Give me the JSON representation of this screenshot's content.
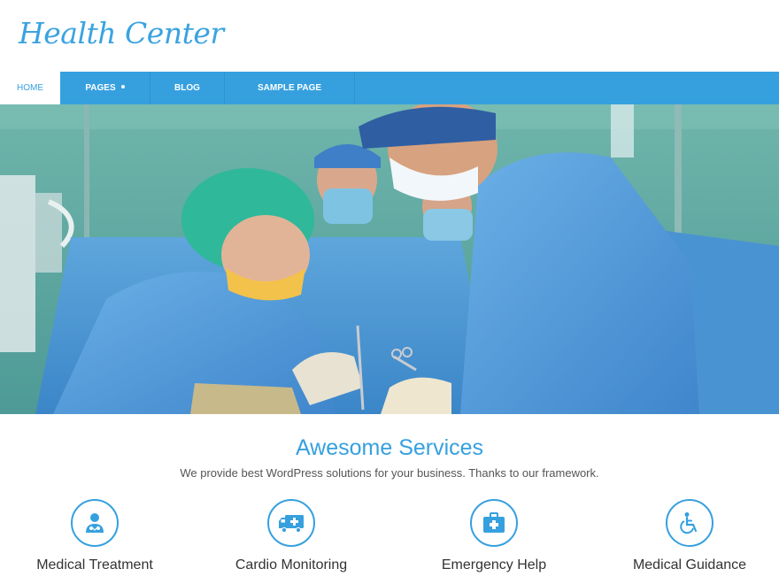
{
  "site": {
    "title": "Health Center"
  },
  "nav": {
    "items": [
      {
        "label": "HOME",
        "active": true
      },
      {
        "label": "PAGES",
        "has_dropdown": true
      },
      {
        "label": "BLOG"
      },
      {
        "label": "SAMPLE PAGE"
      }
    ]
  },
  "services": {
    "title": "Awesome Services",
    "subtitle": "We provide best WordPress solutions for your business. Thanks to our framework.",
    "items": [
      {
        "label": "Medical Treatment",
        "icon": "doctor-icon"
      },
      {
        "label": "Cardio Monitoring",
        "icon": "ambulance-icon"
      },
      {
        "label": "Emergency Help",
        "icon": "medical-kit-icon"
      },
      {
        "label": "Medical Guidance",
        "icon": "wheelchair-icon"
      }
    ]
  },
  "colors": {
    "accent": "#36a0df",
    "nav_divider": "#2f92cd",
    "text": "#333333",
    "subtext": "#555555"
  }
}
